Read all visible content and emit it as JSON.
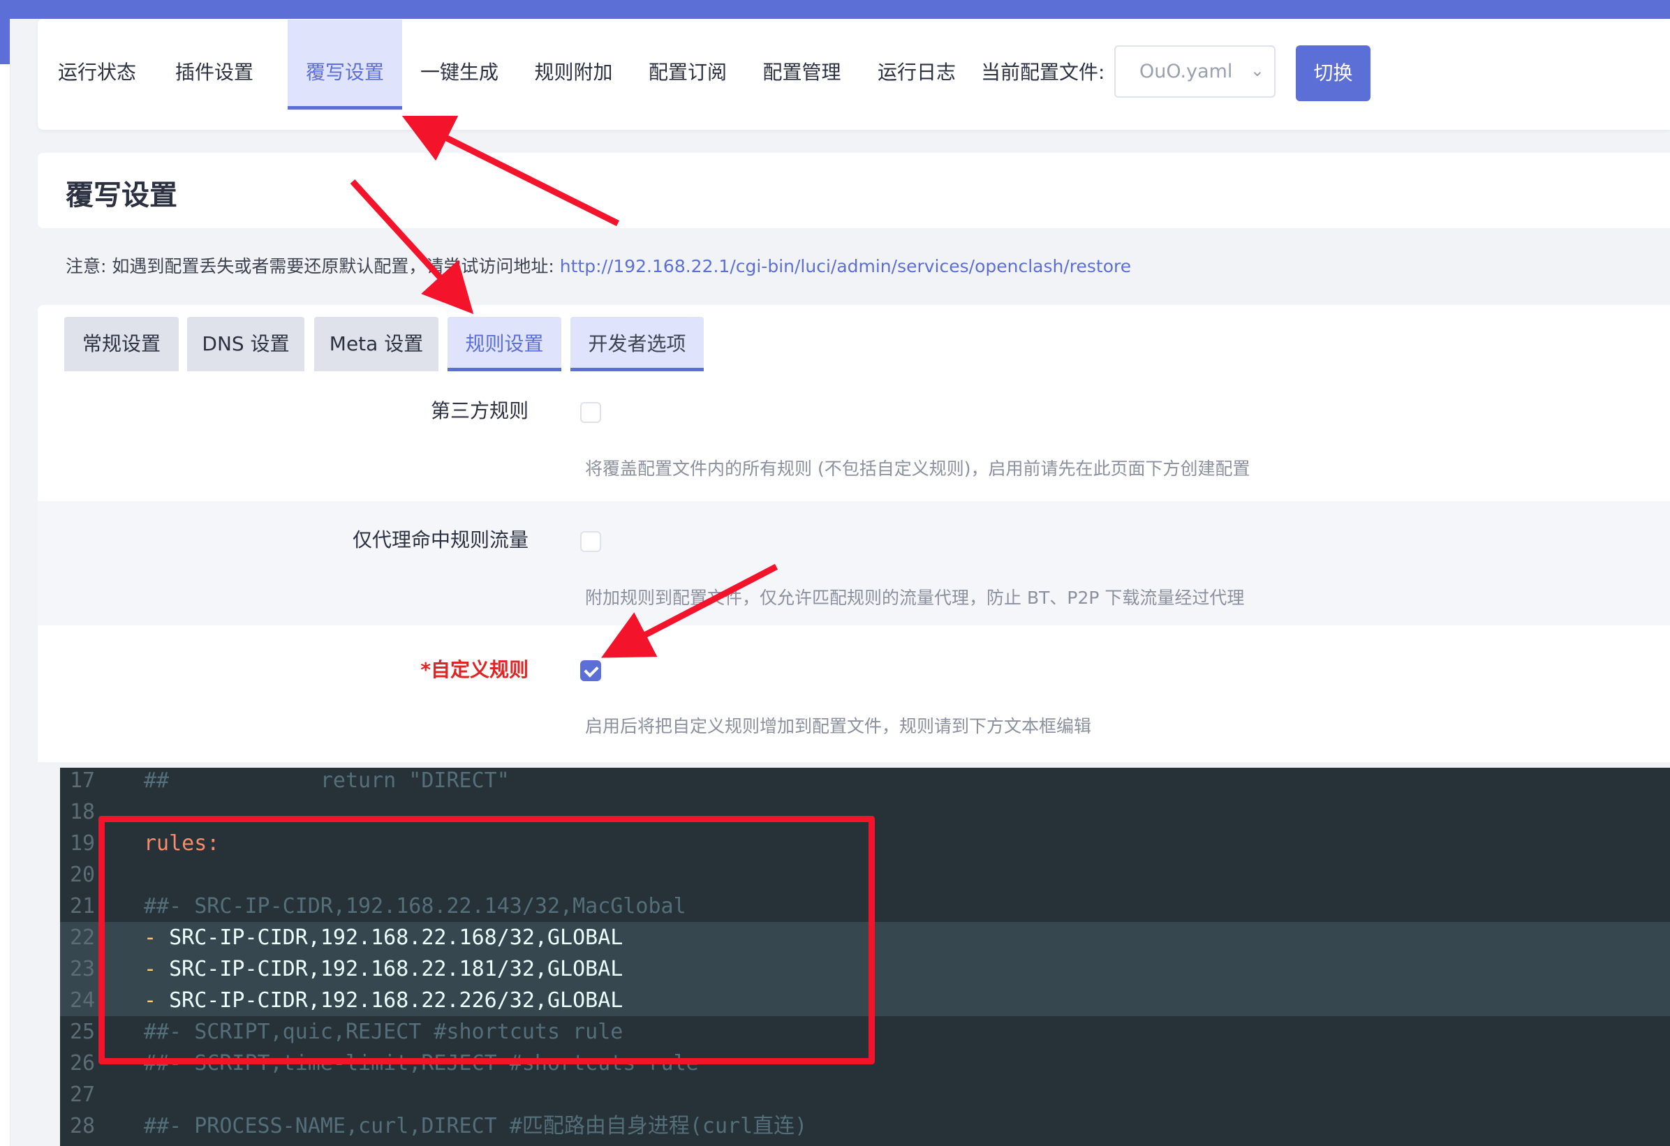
{
  "nav": {
    "items": [
      "运行状态",
      "插件设置",
      "覆写设置",
      "一键生成",
      "规则附加",
      "配置订阅",
      "配置管理",
      "运行日志"
    ],
    "active_index": 2,
    "config_label": "当前配置文件:",
    "config_value": "OuO.yaml",
    "switch_label": "切换"
  },
  "section": {
    "title": "覆写设置",
    "notice_prefix": "注意: 如遇到配置丢失或者需要还原默认配置，请尝试访问地址: ",
    "notice_link": "http://192.168.22.1/cgi-bin/luci/admin/services/openclash/restore"
  },
  "tabs": {
    "items": [
      "常规设置",
      "DNS 设置",
      "Meta 设置",
      "规则设置",
      "开发者选项"
    ],
    "active_index": 3
  },
  "options": [
    {
      "label": "第三方规则",
      "checked": false,
      "required": false,
      "desc": "将覆盖配置文件内的所有规则 (不包括自定义规则)，启用前请先在此页面下方创建配置"
    },
    {
      "label": "仅代理命中规则流量",
      "checked": false,
      "required": false,
      "desc": "附加规则到配置文件，仅允许匹配规则的流量代理，防止 BT、P2P 下载流量经过代理"
    },
    {
      "label": "*自定义规则",
      "checked": true,
      "required": true,
      "desc": "启用后将把自定义规则增加到配置文件，规则请到下方文本框编辑"
    }
  ],
  "editor": {
    "lines": [
      {
        "n": "17",
        "text": "##            return \"DIRECT\"",
        "kind": "comment"
      },
      {
        "n": "18",
        "text": "",
        "kind": "plain"
      },
      {
        "n": "19",
        "text": "rules:",
        "kind": "key"
      },
      {
        "n": "20",
        "text": "",
        "kind": "plain"
      },
      {
        "n": "21",
        "text": "##- SRC-IP-CIDR,192.168.22.143/32,MacGlobal",
        "kind": "comment"
      },
      {
        "n": "22",
        "text": "SRC-IP-CIDR,192.168.22.168/32,GLOBAL",
        "kind": "rule"
      },
      {
        "n": "23",
        "text": "SRC-IP-CIDR,192.168.22.181/32,GLOBAL",
        "kind": "rule"
      },
      {
        "n": "24",
        "text": "SRC-IP-CIDR,192.168.22.226/32,GLOBAL",
        "kind": "rule"
      },
      {
        "n": "25",
        "text": "##- SCRIPT,quic,REJECT #shortcuts rule",
        "kind": "comment"
      },
      {
        "n": "26",
        "text": "##- SCRIPT,time-limit,REJECT #shortcuts rule",
        "kind": "comment"
      },
      {
        "n": "27",
        "text": "",
        "kind": "plain"
      },
      {
        "n": "28",
        "text": "##- PROCESS-NAME,curl,DIRECT #匹配路由自身进程(curl直连)",
        "kind": "comment"
      }
    ],
    "highlight_lines": [
      "22",
      "23",
      "24"
    ]
  },
  "colors": {
    "accent": "#5c6fd6",
    "annotation_red": "#f3132b",
    "required_red": "#e02424",
    "editor_bg": "#263238"
  }
}
